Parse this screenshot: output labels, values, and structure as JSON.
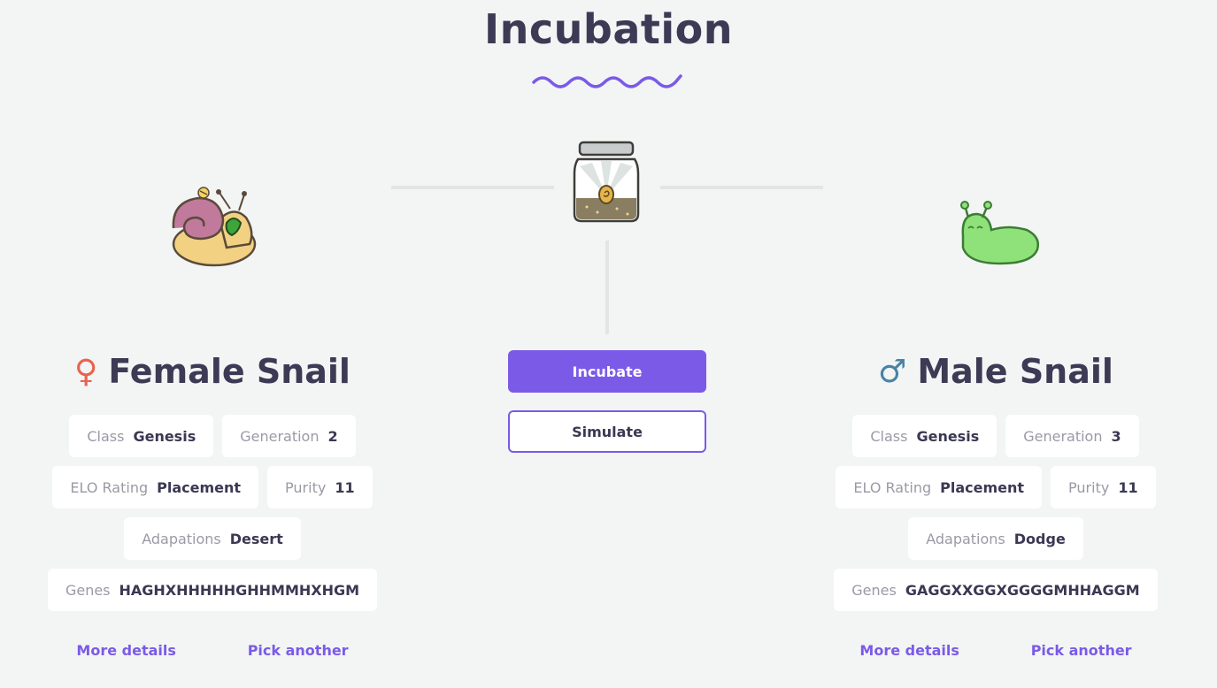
{
  "page": {
    "title": "Incubation"
  },
  "female": {
    "heading": "Female Snail",
    "icon": "female-symbol-icon",
    "sex_glyph": "♀",
    "stats": {
      "class_label": "Class",
      "class_value": "Genesis",
      "generation_label": "Generation",
      "generation_value": "2",
      "elo_label": "ELO Rating",
      "elo_value": "Placement",
      "purity_label": "Purity",
      "purity_value": "11",
      "adaptations_label": "Adapations",
      "adaptations_value": "Desert",
      "genes_label": "Genes",
      "genes_value": "HAGHXHHHHHGHHMMHXHGM"
    },
    "more_details": "More details",
    "pick_another": "Pick another"
  },
  "male": {
    "heading": "Male Snail",
    "icon": "male-symbol-icon",
    "sex_glyph": "♂",
    "stats": {
      "class_label": "Class",
      "class_value": "Genesis",
      "generation_label": "Generation",
      "generation_value": "3",
      "elo_label": "ELO Rating",
      "elo_value": "Placement",
      "purity_label": "Purity",
      "purity_value": "11",
      "adaptations_label": "Adapations",
      "adaptations_value": "Dodge",
      "genes_label": "Genes",
      "genes_value": "GAGGXXGGXGGGGMHHAGGM"
    },
    "more_details": "More details",
    "pick_another": "Pick another"
  },
  "actions": {
    "incubate": "Incubate",
    "simulate": "Simulate"
  },
  "colors": {
    "accent": "#7b5ae8",
    "background": "#f2f5f4",
    "female": "#e9634f",
    "male": "#4a82a6",
    "text": "#3a3852"
  }
}
